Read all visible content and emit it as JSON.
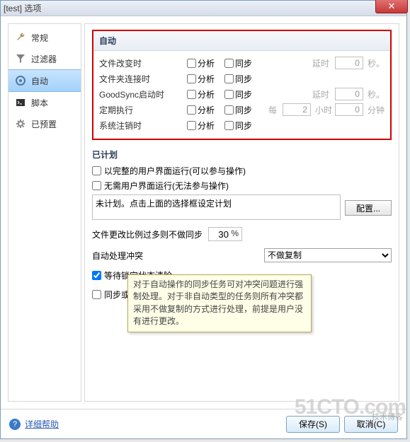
{
  "window": {
    "title": "[test] 选项"
  },
  "sidebar": {
    "items": [
      {
        "label": "常规",
        "icon": "wrench-icon"
      },
      {
        "label": "过滤器",
        "icon": "funnel-icon"
      },
      {
        "label": "自动",
        "icon": "target-icon"
      },
      {
        "label": "脚本",
        "icon": "terminal-icon"
      },
      {
        "label": "已预置",
        "icon": "gear-icon"
      }
    ]
  },
  "auto": {
    "title": "自动",
    "col_analyze": "分析",
    "col_sync": "同步",
    "delay_label": "延时",
    "sec_unit": "秒。",
    "every_label": "每",
    "hour_unit": "小时",
    "min_unit": "分钟",
    "rows": [
      {
        "label": "文件改变时",
        "delay": "0"
      },
      {
        "label": "文件夹连接时"
      },
      {
        "label": "GoodSync启动时",
        "delay": "0"
      },
      {
        "label": "定期执行",
        "every_h": "2",
        "every_m": "0"
      },
      {
        "label": "系统注销时"
      }
    ]
  },
  "planned": {
    "title": "已计划",
    "opt_full": "以完整的用户界面运行(可以参与操作)",
    "opt_noui": "无需用户界面运行(无法参与操作)",
    "plan_text": "未计划。点击上面的选择框设定计划",
    "config_btn": "配置..."
  },
  "ratio": {
    "label": "文件更改比例过多则不做同步",
    "value": "30"
  },
  "conflict": {
    "label": "自动处理冲突",
    "selected": "不做复制"
  },
  "opts": {
    "wait_lock": "等待锁定状态清除",
    "nochange": "同步或分析无变化的"
  },
  "tooltip": {
    "text": "对于自动操作的同步任务可对冲突问题进行强制处理。对于非自动类型的任务则所有冲突都采用不做复制的方式进行处理，前提是用户没有进行更改。"
  },
  "footer": {
    "help": "详细帮助",
    "save": "保存(S)",
    "cancel": "取消(C)"
  },
  "watermark": {
    "main": "51CTO.com",
    "sub": "技术博客"
  }
}
